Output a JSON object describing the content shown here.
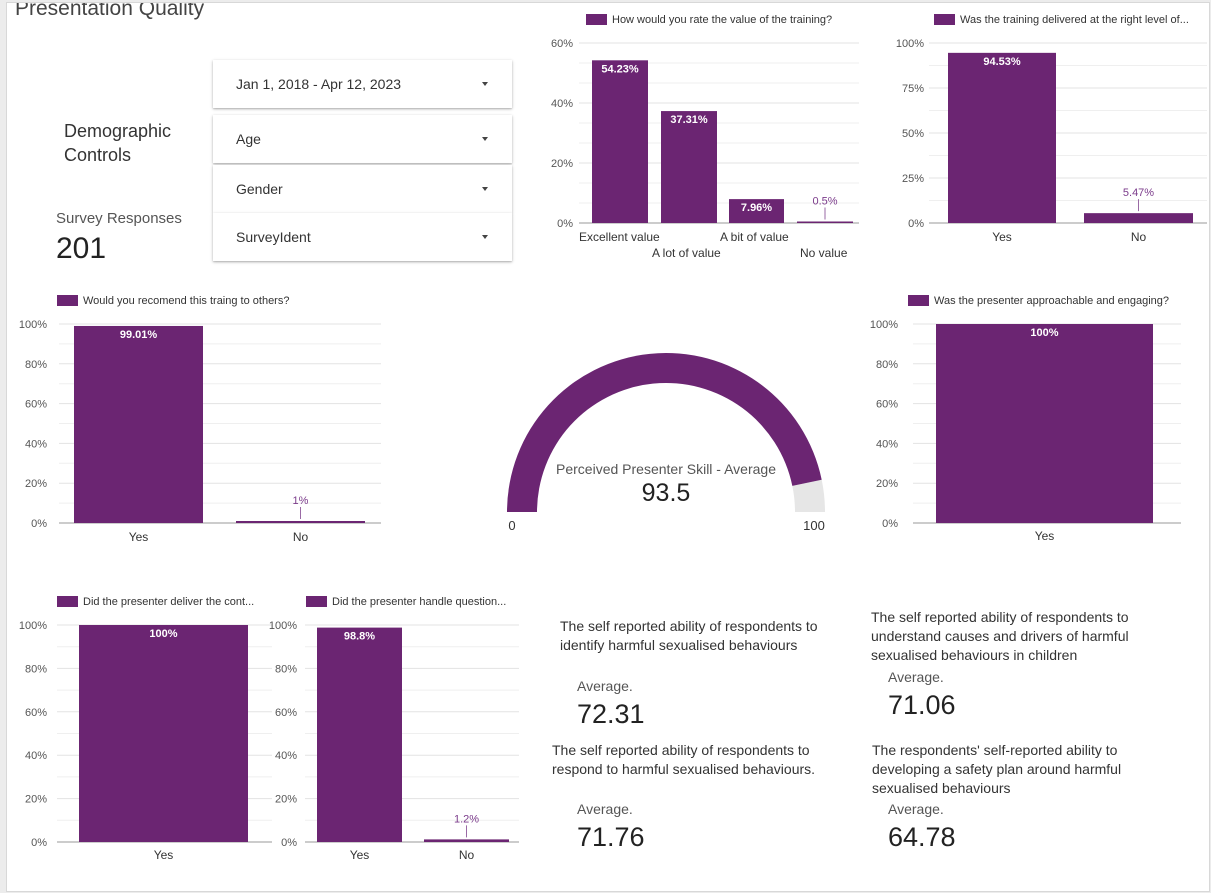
{
  "page": {
    "title": "Presentation Quality",
    "demographic_title": "Demographic Controls",
    "survey_responses_label": "Survey Responses",
    "survey_responses_value": "201"
  },
  "filters": {
    "date_range": "Jan 1, 2018 - Apr 12, 2023",
    "age": "Age",
    "gender": "Gender",
    "survey_ident": "SurveyIdent"
  },
  "colors": {
    "bar": "#6b2572",
    "gauge_track": "#e6e6e6",
    "grid": "#e3e3e3"
  },
  "chart_data": [
    {
      "id": "value_of_training",
      "type": "bar",
      "legend": "How would you rate the value of the training?",
      "categories": [
        "Excellent value",
        "A lot of value",
        "A bit of value",
        "No value"
      ],
      "values": [
        54.23,
        37.31,
        7.96,
        0.5
      ],
      "data_labels": [
        "54.23%",
        "37.31%",
        "7.96%",
        "0.5%"
      ],
      "yticks": [
        "0%",
        "20%",
        "40%",
        "60%"
      ],
      "ylim": [
        0,
        60
      ]
    },
    {
      "id": "right_level",
      "type": "bar",
      "legend": "Was the training delivered at the right level of...",
      "categories": [
        "Yes",
        "No"
      ],
      "values": [
        94.53,
        5.47
      ],
      "data_labels": [
        "94.53%",
        "5.47%"
      ],
      "yticks": [
        "0%",
        "25%",
        "50%",
        "75%",
        "100%"
      ],
      "ylim": [
        0,
        100
      ]
    },
    {
      "id": "recommend",
      "type": "bar",
      "legend": "Would you recomend this traing to others?",
      "categories": [
        "Yes",
        "No"
      ],
      "values": [
        99.01,
        1
      ],
      "data_labels": [
        "99.01%",
        "1%"
      ],
      "yticks": [
        "0%",
        "20%",
        "40%",
        "60%",
        "80%",
        "100%"
      ],
      "ylim": [
        0,
        100
      ]
    },
    {
      "id": "approachable",
      "type": "bar",
      "legend": "Was the presenter approachable and engaging?",
      "categories": [
        "Yes"
      ],
      "values": [
        100
      ],
      "data_labels": [
        "100%"
      ],
      "yticks": [
        "0%",
        "20%",
        "40%",
        "60%",
        "80%",
        "100%"
      ],
      "ylim": [
        0,
        100
      ]
    },
    {
      "id": "deliver_content",
      "type": "bar",
      "legend": "Did the presenter deliver the cont...",
      "categories": [
        "Yes"
      ],
      "values": [
        100
      ],
      "data_labels": [
        "100%"
      ],
      "yticks": [
        "0%",
        "20%",
        "40%",
        "60%",
        "80%",
        "100%"
      ],
      "ylim": [
        0,
        100
      ]
    },
    {
      "id": "handle_questions",
      "type": "bar",
      "legend": "Did the presenter handle question...",
      "categories": [
        "Yes",
        "No"
      ],
      "values": [
        98.8,
        1.2
      ],
      "data_labels": [
        "98.8%",
        "1.2%"
      ],
      "yticks": [
        "0%",
        "20%",
        "40%",
        "60%",
        "80%",
        "100%"
      ],
      "ylim": [
        0,
        100
      ]
    }
  ],
  "gauge": {
    "title": "Perceived Presenter Skill - Average",
    "value": 93.5,
    "value_label": "93.5",
    "min_label": "0",
    "max_label": "100",
    "min": 0,
    "max": 100
  },
  "kpis": [
    {
      "description": "The self reported ability of respondents to identify harmful sexualised behaviours",
      "avg_label": "Average.",
      "value": "72.31"
    },
    {
      "description": "The self reported ability of respondents to understand causes and drivers of harmful sexualised behaviours in children",
      "avg_label": "Average.",
      "value": "71.06"
    },
    {
      "description": "The self reported ability of respondents to respond to harmful sexualised behaviours.",
      "avg_label": "Average.",
      "value": "71.76"
    },
    {
      "description": "The respondents' self-reported ability to developing a safety plan around harmful sexualised behaviours",
      "avg_label": "Average.",
      "value": "64.78"
    }
  ]
}
